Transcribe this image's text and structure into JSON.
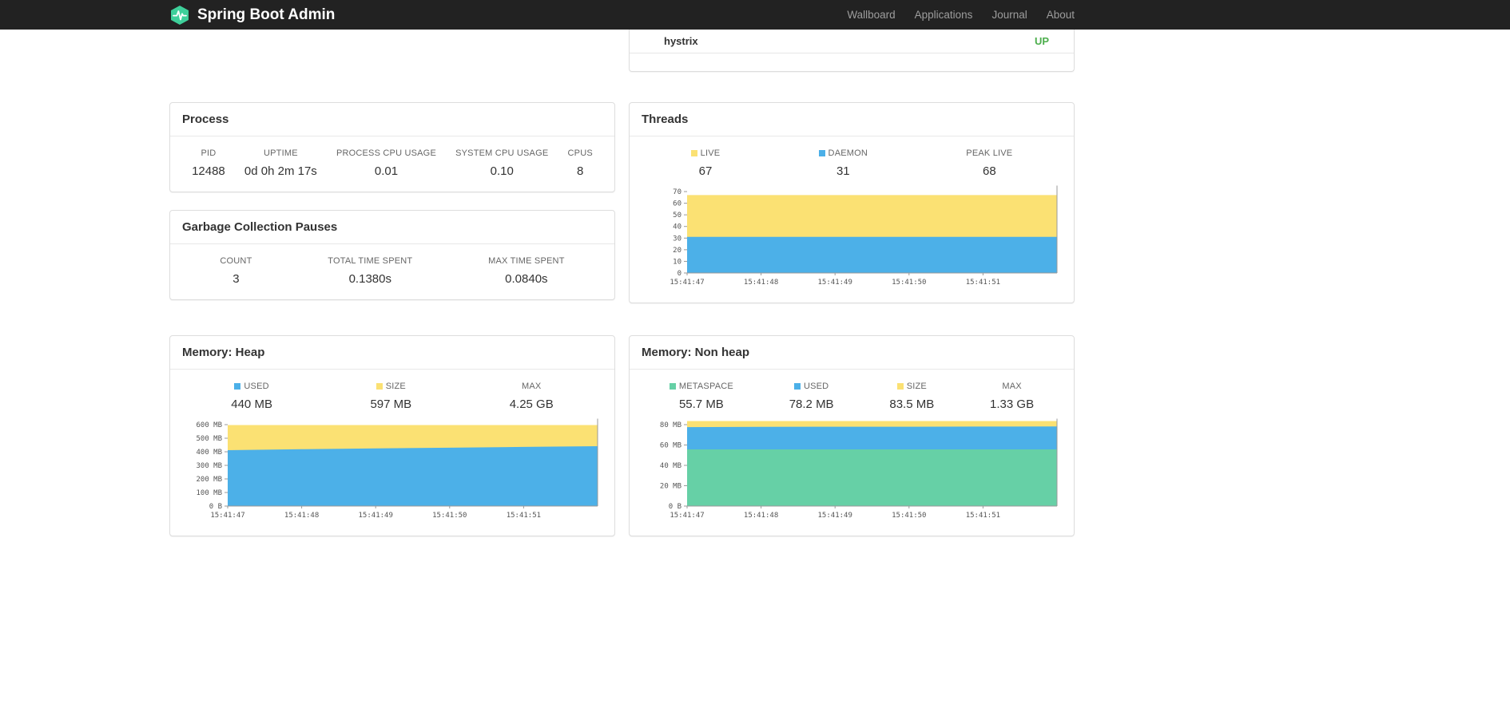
{
  "navbar": {
    "brand": "Spring Boot Admin",
    "links": [
      {
        "label": "Wallboard"
      },
      {
        "label": "Applications"
      },
      {
        "label": "Journal"
      },
      {
        "label": "About"
      }
    ]
  },
  "colors": {
    "logo_green": "#3ecf9a",
    "status_up": "#4cae4c",
    "series_yellow": "#fbe173",
    "series_blue": "#4cb0e8",
    "series_green": "#66d0a6",
    "navbar_bg": "#222222"
  },
  "application_row": {
    "name": "hystrix",
    "status": "UP"
  },
  "panels": {
    "process": {
      "title": "Process",
      "metrics": [
        {
          "label": "PID",
          "value": "12488"
        },
        {
          "label": "UPTIME",
          "value": "0d 0h 2m 17s"
        },
        {
          "label": "PROCESS CPU USAGE",
          "value": "0.01"
        },
        {
          "label": "SYSTEM CPU USAGE",
          "value": "0.10"
        },
        {
          "label": "CPUS",
          "value": "8"
        }
      ]
    },
    "gc": {
      "title": "Garbage Collection Pauses",
      "metrics": [
        {
          "label": "COUNT",
          "value": "3"
        },
        {
          "label": "TOTAL TIME SPENT",
          "value": "0.1380s"
        },
        {
          "label": "MAX TIME SPENT",
          "value": "0.0840s"
        }
      ]
    },
    "threads": {
      "title": "Threads",
      "metrics": [
        {
          "label": "LIVE",
          "value": "67",
          "swatch": "#fbe173"
        },
        {
          "label": "DAEMON",
          "value": "31",
          "swatch": "#4cb0e8"
        },
        {
          "label": "PEAK LIVE",
          "value": "68"
        }
      ]
    },
    "heap": {
      "title": "Memory: Heap",
      "metrics": [
        {
          "label": "USED",
          "value": "440 MB",
          "swatch": "#4cb0e8"
        },
        {
          "label": "SIZE",
          "value": "597 MB",
          "swatch": "#fbe173"
        },
        {
          "label": "MAX",
          "value": "4.25 GB"
        }
      ]
    },
    "nonheap": {
      "title": "Memory: Non heap",
      "metrics": [
        {
          "label": "METASPACE",
          "value": "55.7 MB",
          "swatch": "#66d0a6"
        },
        {
          "label": "USED",
          "value": "78.2 MB",
          "swatch": "#4cb0e8"
        },
        {
          "label": "SIZE",
          "value": "83.5 MB",
          "swatch": "#fbe173"
        },
        {
          "label": "MAX",
          "value": "1.33 GB"
        }
      ]
    }
  },
  "chart_data": [
    {
      "id": "threads",
      "type": "area",
      "title": "Threads",
      "legend_position": "top",
      "grid": false,
      "x_labels": [
        "15:41:47",
        "15:41:48",
        "15:41:49",
        "15:41:50",
        "15:41:51"
      ],
      "ylim": [
        0,
        70
      ],
      "yticks": [
        [
          0,
          "0"
        ],
        [
          10,
          "10"
        ],
        [
          20,
          "20"
        ],
        [
          30,
          "30"
        ],
        [
          40,
          "40"
        ],
        [
          50,
          "50"
        ],
        [
          60,
          "60"
        ],
        [
          70,
          "70"
        ]
      ],
      "series": [
        {
          "name": "LIVE",
          "color": "#fbe173",
          "values": [
            67,
            67,
            67,
            67,
            67,
            67
          ]
        },
        {
          "name": "DAEMON",
          "color": "#4cb0e8",
          "values": [
            31,
            31,
            31,
            31,
            31,
            31
          ]
        }
      ],
      "annotations": {
        "peak_live": 68
      }
    },
    {
      "id": "heap",
      "type": "area",
      "title": "Memory: Heap",
      "unit": "MB",
      "legend_position": "top",
      "grid": false,
      "x_labels": [
        "15:41:47",
        "15:41:48",
        "15:41:49",
        "15:41:50",
        "15:41:51"
      ],
      "ylim": [
        0,
        600
      ],
      "yticks": [
        [
          0,
          "0 B"
        ],
        [
          100,
          "100 MB"
        ],
        [
          200,
          "200 MB"
        ],
        [
          300,
          "300 MB"
        ],
        [
          400,
          "400 MB"
        ],
        [
          500,
          "500 MB"
        ],
        [
          600,
          "600 MB"
        ]
      ],
      "series": [
        {
          "name": "SIZE",
          "color": "#fbe173",
          "values": [
            597,
            597,
            597,
            597,
            597,
            597
          ]
        },
        {
          "name": "USED",
          "color": "#4cb0e8",
          "values": [
            412,
            419,
            425,
            430,
            436,
            441
          ]
        }
      ],
      "annotations": {
        "max": "4.25 GB"
      }
    },
    {
      "id": "nonheap",
      "type": "area",
      "title": "Memory: Non heap",
      "unit": "MB",
      "legend_position": "top",
      "grid": false,
      "x_labels": [
        "15:41:47",
        "15:41:48",
        "15:41:49",
        "15:41:50",
        "15:41:51"
      ],
      "ylim": [
        0,
        80
      ],
      "yticks": [
        [
          0,
          "0 B"
        ],
        [
          20,
          "20 MB"
        ],
        [
          40,
          "40 MB"
        ],
        [
          60,
          "60 MB"
        ],
        [
          80,
          "80 MB"
        ]
      ],
      "series": [
        {
          "name": "SIZE",
          "color": "#fbe173",
          "values": [
            83.5,
            83.5,
            83.5,
            83.5,
            83.5,
            83.5
          ]
        },
        {
          "name": "USED",
          "color": "#4cb0e8",
          "values": [
            77.6,
            77.8,
            78.0,
            78.0,
            78.1,
            78.2
          ]
        },
        {
          "name": "METASPACE",
          "color": "#66d0a6",
          "values": [
            55.7,
            55.7,
            55.7,
            55.7,
            55.7,
            55.7
          ]
        }
      ],
      "annotations": {
        "max": "1.33 GB"
      }
    }
  ]
}
